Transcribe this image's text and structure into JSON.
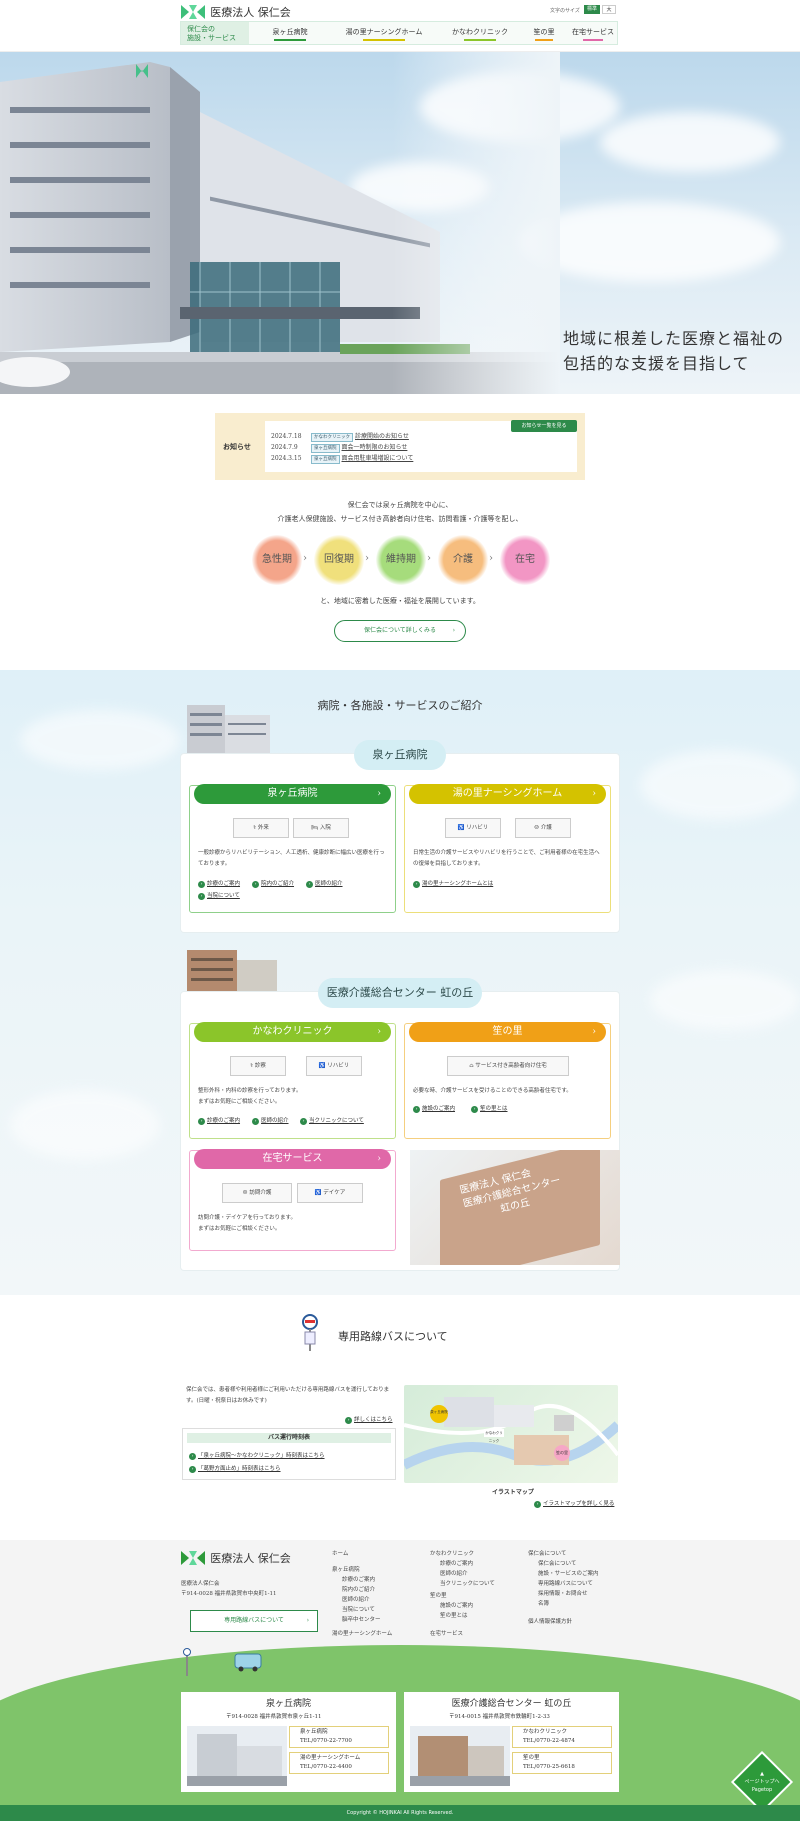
{
  "header": {
    "brand": "医療法人 保仁会",
    "font_size_label": "文字のサイズ",
    "font_size_standard": "標準",
    "font_size_large": "大",
    "nav_label_line1": "保仁会の",
    "nav_label_line2": "施設・サービス",
    "nav_items": [
      {
        "label": "泉ヶ丘病院",
        "color": "#2d9a3a"
      },
      {
        "label": "湯の里ナーシングホーム",
        "color": "#d4c200"
      },
      {
        "label": "かなわクリニック",
        "color": "#8bc52a"
      },
      {
        "label": "笙の里",
        "color": "#f0a017"
      },
      {
        "label": "在宅サービス",
        "color": "#e068a8"
      }
    ]
  },
  "hero": {
    "line1": "地域に根差した医療と福祉の",
    "line2": "包括的な支援を目指して"
  },
  "news": {
    "label": "お知らせ",
    "more": "お知らせ一覧を見る",
    "items": [
      {
        "date": "2024.7.18",
        "tag": "かなわクリニック",
        "title": "診療開始のお知らせ"
      },
      {
        "date": "2024.7.9",
        "tag": "泉ヶ丘病院",
        "title": "面会一時制限のお知らせ"
      },
      {
        "date": "2024.3.15",
        "tag": "泉ヶ丘病院",
        "title": "面会用駐車場増設について"
      }
    ]
  },
  "intro": {
    "line1": "保仁会では泉ヶ丘病院を中心に、",
    "line2": "介護老人保健施設、サービス付き高齢者向け住宅、訪問看護・介護等を配し、",
    "stages": [
      {
        "label": "急性期",
        "color": "#f4a58a"
      },
      {
        "label": "回復期",
        "color": "#f0e07c"
      },
      {
        "label": "維持期",
        "color": "#a6dc7c"
      },
      {
        "label": "介護",
        "color": "#f6bd7e"
      },
      {
        "label": "在宅",
        "color": "#f296c4"
      }
    ],
    "line3": "と、地域に密着した医療・福祉を展開しています。",
    "button": "保仁会について詳しくみる"
  },
  "services": {
    "title": "病院・各施設・サービスのご紹介",
    "group1": "泉ヶ丘病院",
    "group2": "医療介護総合センター 虹の丘",
    "cards": {
      "izumigaoka": {
        "title": "泉ヶ丘病院",
        "btn1": "外来",
        "btn2": "入院",
        "desc": "一般診療からリハビリテーション、人工透析、健康診断に幅広い医療を行っております。",
        "links": [
          "診療のご案内",
          "院内のご紹介",
          "医師の紹介",
          "当院について"
        ]
      },
      "yunosato": {
        "title": "湯の里ナーシングホーム",
        "btn1": "リハビリ",
        "btn2": "介護",
        "desc": "日常生活の介護サービスやリハビリを行うことで、ご利用者様の在宅生活への復帰を目指しております。",
        "links": [
          "湯の里ナーシングホームとは"
        ]
      },
      "kanawa": {
        "title": "かなわクリニック",
        "btn1": "診察",
        "btn2": "リハビリ",
        "desc1": "整形外科・内科の診察を行っております。",
        "desc2": "まずはお気軽にご相談ください。",
        "links": [
          "診療のご案内",
          "医師の紹介",
          "当クリニックについて"
        ]
      },
      "shonosato": {
        "title": "笙の里",
        "btn1": "サービス付き高齢者向け住宅",
        "desc": "必要な時、介護サービスを受けることのできる高齢者住宅です。",
        "links": [
          "施設のご案内",
          "笙の里とは"
        ]
      },
      "zaitaku": {
        "title": "在宅サービス",
        "btn1": "訪問介護",
        "btn2": "デイケア",
        "desc1": "訪問介護・デイケアを行っております。",
        "desc2": "まずはお気軽にご相談ください。"
      }
    },
    "sign_line1": "医療法人 保仁会",
    "sign_line2": "医療介護総合センター",
    "sign_line3": "虹の丘"
  },
  "bus": {
    "title": "専用路線バスについて",
    "desc": "保仁会では、患者様や利用者様にご利用いただける専用路線バスを運行しております。(日曜・祝祭日はお休みです)",
    "detail_link": "詳しくはこちら",
    "timetable_title": "バス運行時刻表",
    "timetable_links": [
      "「泉ヶ丘病院〜かなわクリニック」時刻表はこちら",
      "「葛野方面止め」時刻表はこちら"
    ],
    "map_caption": "イラストマップ",
    "map_link": "イラストマップを詳しく見る",
    "map_labels": [
      "泉ヶ丘病院",
      "かなわクリニック",
      "笙の里"
    ]
  },
  "footer": {
    "brand": "医療法人 保仁会",
    "org": "医療法人保仁会",
    "address": "〒914-0028 福井県敦賀市中央町1-11",
    "bus_button": "専用路線バスについて",
    "col1": [
      "ホーム",
      "泉ヶ丘病院",
      "診療のご案内",
      "院内のご紹介",
      "医師の紹介",
      "当院について",
      "湯の里ナーシングホーム"
    ],
    "col1_extra": "脳卒中センター",
    "col2": [
      "かなわクリニック",
      "診療のご案内",
      "医師の紹介",
      "当クリニックについて",
      "笙の里",
      "施設のご案内",
      "笙の里とは",
      "在宅サービス"
    ],
    "col3": [
      "保仁会について",
      "保仁会について",
      "施設・サービスのご案内",
      "専用路線バスについて",
      "採用情報・お問合せ",
      "名簿",
      "個人情報保護方針"
    ],
    "card1": {
      "title": "泉ヶ丘病院",
      "address": "〒914-0028 福井県敦賀市泉ヶ丘1-11",
      "tel1_name": "泉ヶ丘病院",
      "tel1": "TEL/0770-22-7700",
      "tel2_name": "湯の里ナーシングホーム",
      "tel2": "TEL/0770-22-4400"
    },
    "card2": {
      "title": "医療介護総合センター 虹の丘",
      "address": "〒914-0015 福井県敦賀市鉄輪町1-2-33",
      "tel1_name": "かなわクリニック",
      "tel1": "TEL/0770-22-4874",
      "tel2_name": "笙の里",
      "tel2": "TEL/0770-25-6618"
    },
    "pagetop": "ページトップへ",
    "pagetop_en": "Pagetop",
    "copyright": "Copyright © HOJINKAI All Rights Reserved."
  }
}
